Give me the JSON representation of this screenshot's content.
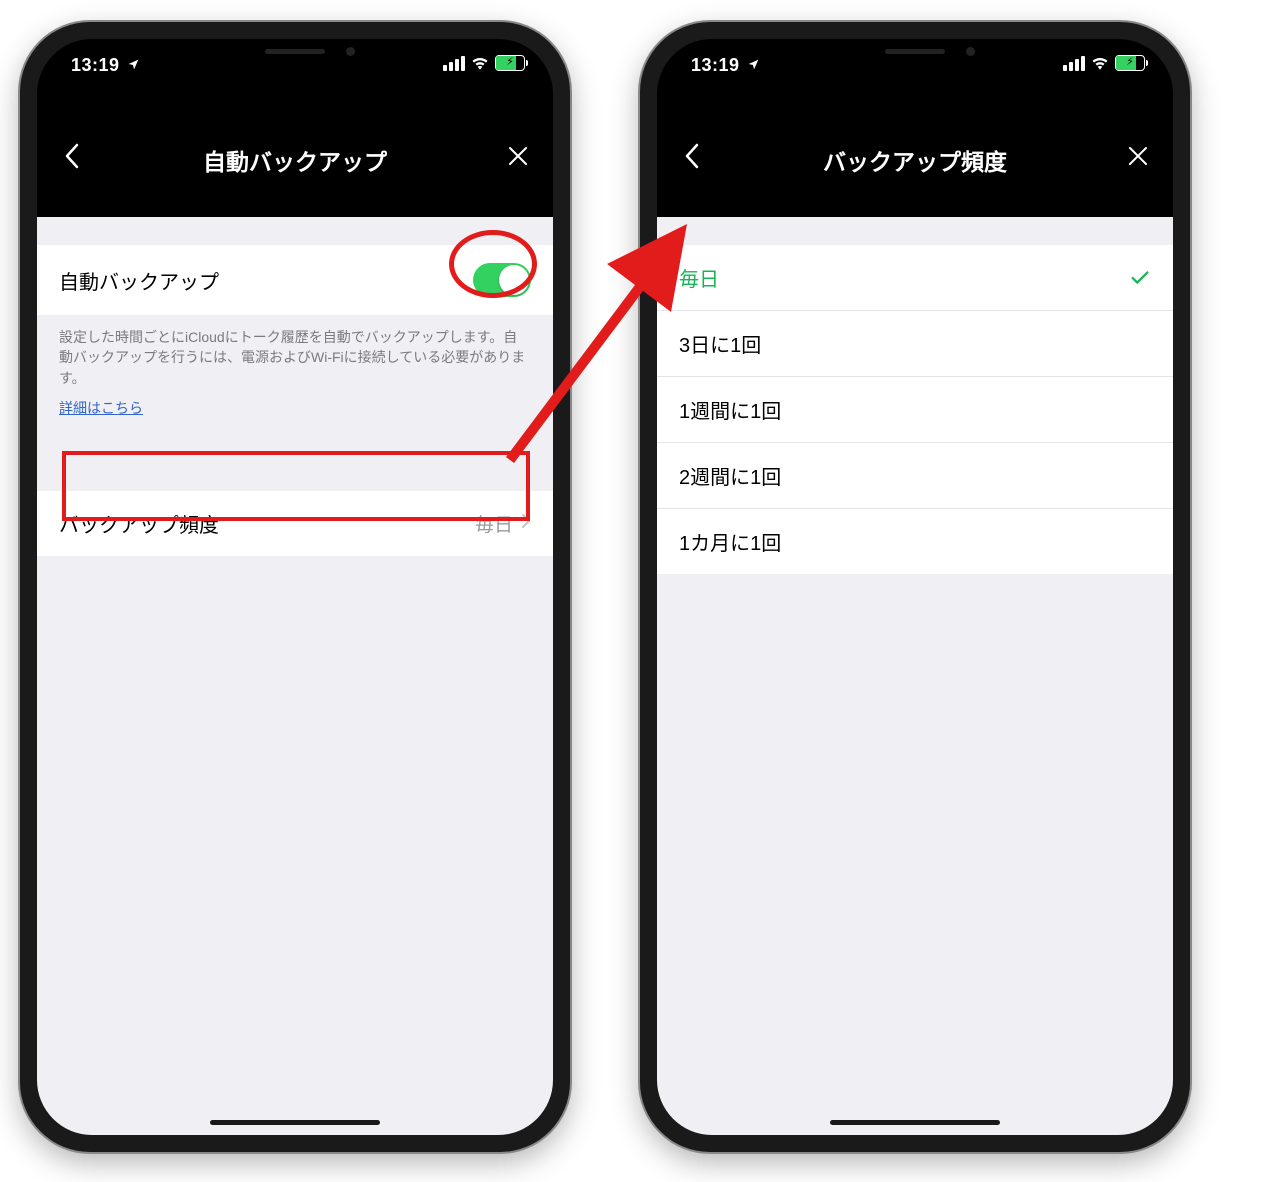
{
  "status": {
    "time": "13:19",
    "location_arrow": "➤"
  },
  "left": {
    "title": "自動バックアップ",
    "cell_auto_label": "自動バックアップ",
    "description": "設定した時間ごとにiCloudにトーク履歴を自動でバックアップします。自動バックアップを行うには、電源およびWi-Fiに接続している必要があります。",
    "link": "詳細はこちら",
    "freq_label": "バックアップ頻度",
    "freq_value": "毎日"
  },
  "right": {
    "title": "バックアップ頻度",
    "options": {
      "0": "毎日",
      "1": "3日に1回",
      "2": "1週間に1回",
      "3": "2週間に1回",
      "4": "1カ月に1回"
    }
  }
}
